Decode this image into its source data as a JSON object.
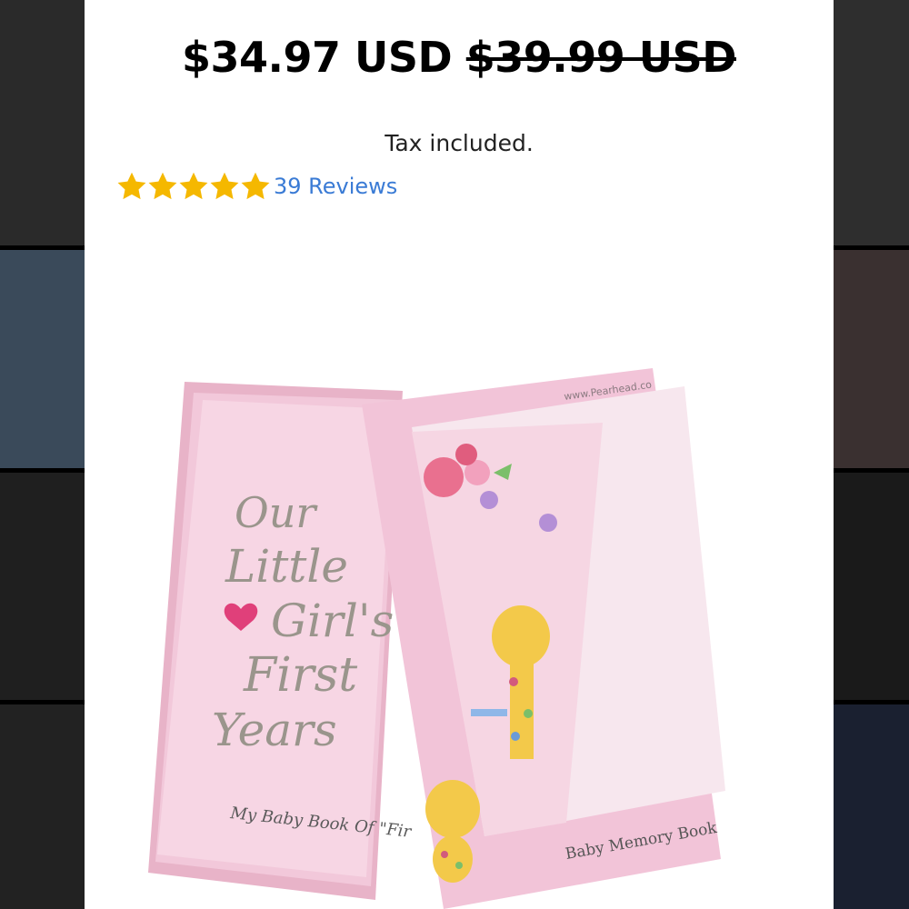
{
  "product": {
    "sale_price": "$34.97 USD",
    "original_price": "$39.99 USD",
    "tax_note": "Tax included.",
    "rating_stars": 5,
    "reviews_label": "39 Reviews"
  },
  "image": {
    "box_site": "www.Pearhead.co",
    "box_label": "Baby Memory Book",
    "book_title_lines": [
      "Our",
      "Little",
      "Girl's",
      "First",
      "Years"
    ],
    "book_subtitle": "My Baby Book Of \"Fir"
  },
  "colors": {
    "star": "#f5b800",
    "link": "#3a7bd5",
    "box_pink": "#f3c9dc"
  }
}
